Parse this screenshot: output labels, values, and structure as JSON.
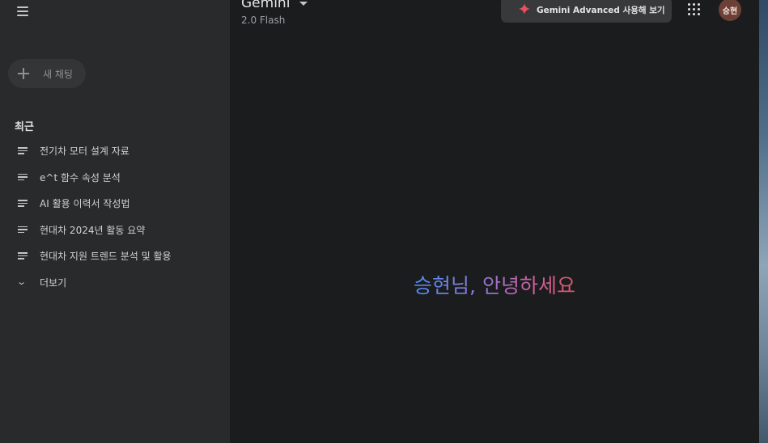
{
  "sidebar": {
    "new_chat_label": "새 채팅",
    "recent_heading": "최근",
    "recent_items": [
      {
        "label": "전기차 모터 설계 자료",
        "icon": "chat-lines-icon"
      },
      {
        "label": "e^t 함수 속성 분석",
        "icon": "chat-lines-icon"
      },
      {
        "label": "AI 활용 이력서 작성법",
        "icon": "chat-lines-icon"
      },
      {
        "label": "현대차 2024년 활동 요약",
        "icon": "chat-lines-icon"
      },
      {
        "label": "현대차 지원 트렌드 분석 및 활용",
        "icon": "chat-lines-icon"
      }
    ],
    "more_label": "더보기"
  },
  "header": {
    "title": "Gemini",
    "model": "2.0 Flash",
    "advanced_button_label": "Gemini Advanced 사용해 보기",
    "avatar_initials": "승현"
  },
  "main": {
    "greeting": "승현님, 안녕하세요"
  },
  "colors": {
    "sidebar_bg": "#282a2c",
    "main_bg": "#1b1c1d",
    "spark_red": "#e8515f",
    "gradient_start": "#4f8ef0",
    "gradient_end": "#d9576b"
  }
}
